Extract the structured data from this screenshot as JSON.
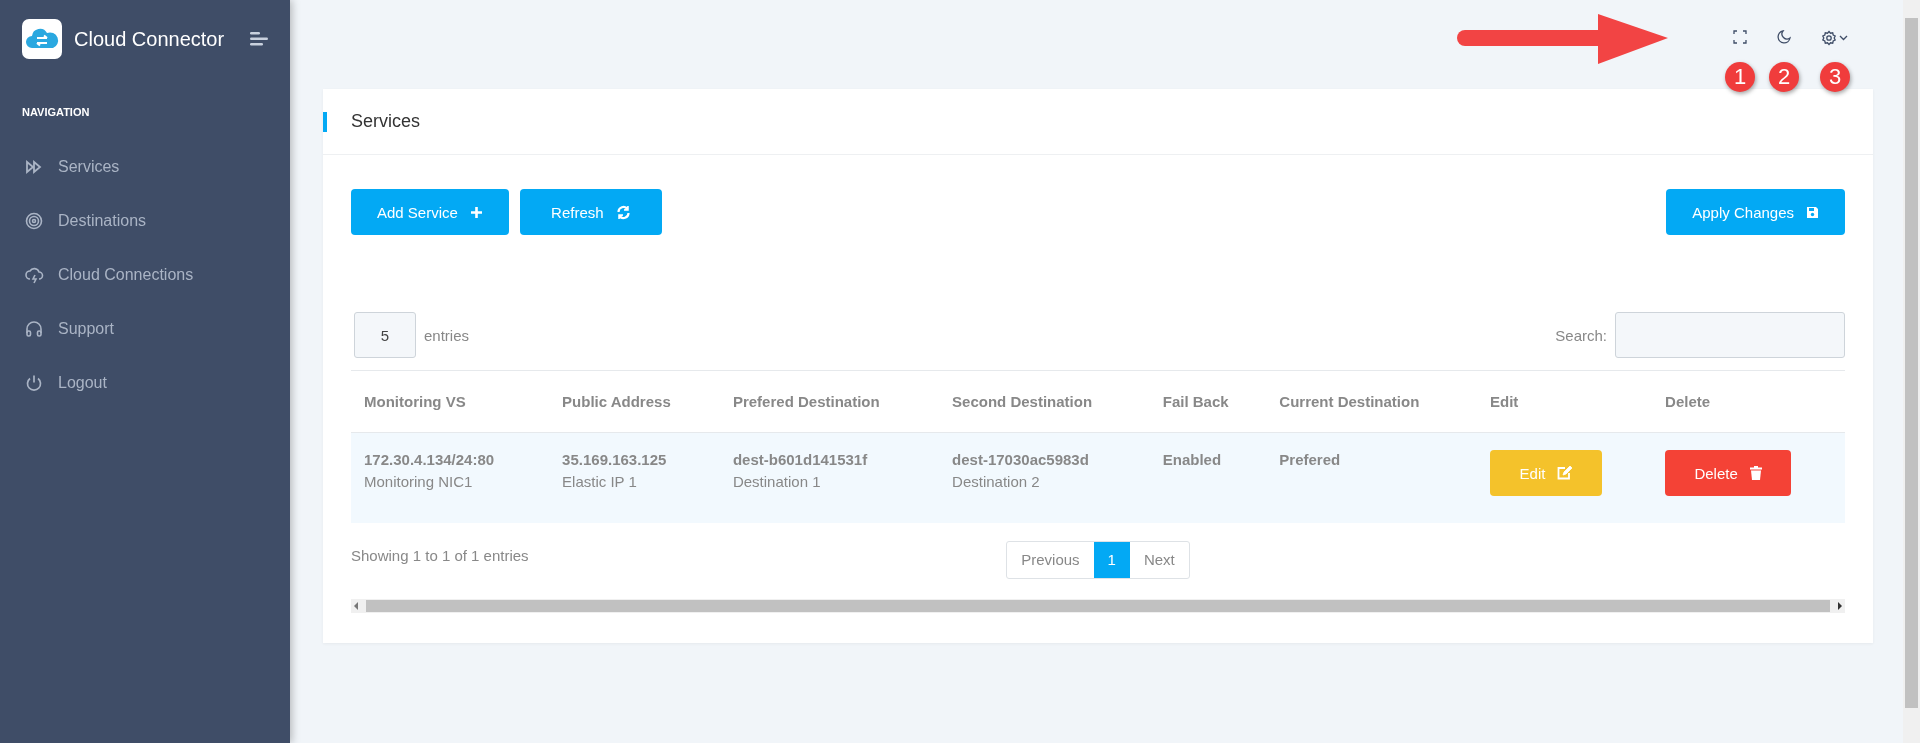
{
  "sidebar": {
    "brand": "Cloud Connector",
    "nav_heading": "NAVIGATION",
    "items": [
      {
        "label": "Services"
      },
      {
        "label": "Destinations"
      },
      {
        "label": "Cloud Connections"
      },
      {
        "label": "Support"
      },
      {
        "label": "Logout"
      }
    ]
  },
  "annotations": {
    "badges": [
      "1",
      "2",
      "3"
    ]
  },
  "card": {
    "title": "Services",
    "buttons": {
      "add": "Add Service",
      "refresh": "Refresh",
      "apply": "Apply Changes"
    },
    "page_size": "5",
    "entries_label": "entries",
    "search_label": "Search:",
    "table": {
      "columns": [
        "Monitoring VS",
        "Public Address",
        "Prefered Destination",
        "Second Destination",
        "Fail Back",
        "Current Destination",
        "Edit",
        "Delete"
      ],
      "rows": [
        {
          "cells": [
            {
              "primary": "172.30.4.134/24:80",
              "secondary": "Monitoring NIC1"
            },
            {
              "primary": "35.169.163.125",
              "secondary": "Elastic IP 1"
            },
            {
              "primary": "dest-b601d141531f",
              "secondary": "Destination 1"
            },
            {
              "primary": "dest-17030ac5983d",
              "secondary": "Destination 2"
            },
            {
              "primary": "Enabled"
            },
            {
              "primary": "Prefered"
            }
          ],
          "edit": "Edit",
          "delete": "Delete"
        }
      ]
    },
    "info": "Showing 1 to 1 of 1 entries",
    "pagination": {
      "previous": "Previous",
      "pages": [
        {
          "label": "1",
          "selected": true
        }
      ],
      "next": "Next"
    }
  }
}
